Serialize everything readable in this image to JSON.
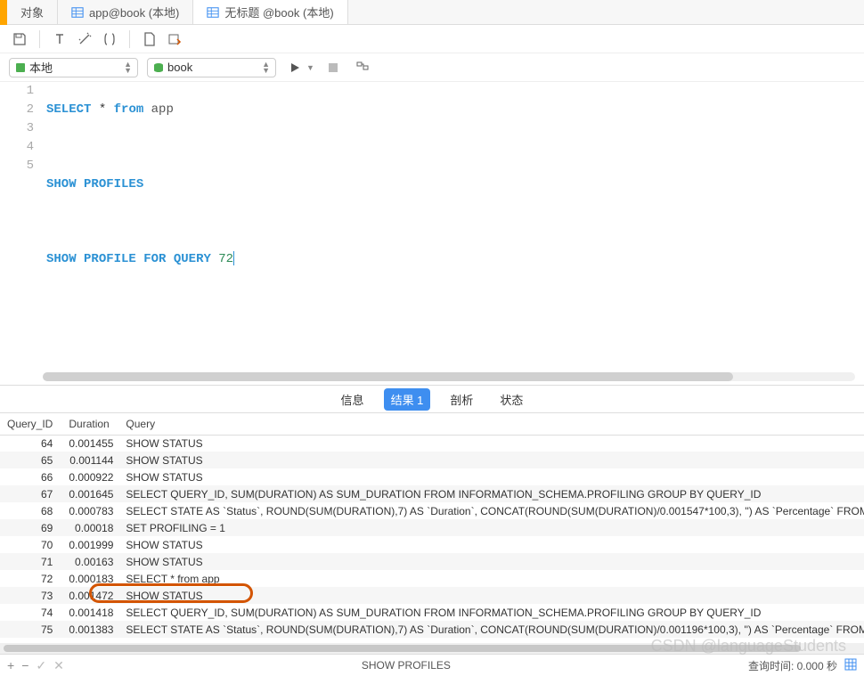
{
  "tabs": {
    "t0": {
      "label": "对象"
    },
    "t1": {
      "label": "app@book (本地)"
    },
    "t2": {
      "label": "无标题 @book (本地)"
    }
  },
  "dropdowns": {
    "connection": "本地",
    "database": "book"
  },
  "editor": {
    "line_numbers": [
      "1",
      "2",
      "3",
      "4",
      "5"
    ],
    "lines": {
      "l1": {
        "a": "SELECT",
        "b": "*",
        "c": "from",
        "d": "app"
      },
      "l3": {
        "a": "SHOW",
        "b": "PROFILES"
      },
      "l5": {
        "a": "SHOW",
        "b": "PROFILE",
        "c": "FOR",
        "d": "QUERY",
        "e": "72"
      }
    }
  },
  "result_tabs": {
    "info": "信息",
    "result1": "结果 1",
    "profile": "剖析",
    "status": "状态"
  },
  "table": {
    "headers": {
      "qid": "Query_ID",
      "dur": "Duration",
      "query": "Query"
    },
    "rows": [
      {
        "qid": "64",
        "dur": "0.001455",
        "query": "SHOW STATUS"
      },
      {
        "qid": "65",
        "dur": "0.001144",
        "query": "SHOW STATUS"
      },
      {
        "qid": "66",
        "dur": "0.000922",
        "query": "SHOW STATUS"
      },
      {
        "qid": "67",
        "dur": "0.001645",
        "query": "SELECT QUERY_ID, SUM(DURATION) AS SUM_DURATION FROM INFORMATION_SCHEMA.PROFILING GROUP BY QUERY_ID"
      },
      {
        "qid": "68",
        "dur": "0.000783",
        "query": "SELECT STATE AS `Status`, ROUND(SUM(DURATION),7) AS `Duration`, CONCAT(ROUND(SUM(DURATION)/0.001547*100,3), '') AS `Percentage` FROM"
      },
      {
        "qid": "69",
        "dur": "0.00018",
        "query": "SET PROFILING = 1"
      },
      {
        "qid": "70",
        "dur": "0.001999",
        "query": "SHOW STATUS"
      },
      {
        "qid": "71",
        "dur": "0.00163",
        "query": "SHOW STATUS"
      },
      {
        "qid": "72",
        "dur": "0.000183",
        "query": "SELECT * from app"
      },
      {
        "qid": "73",
        "dur": "0.001472",
        "query": "SHOW STATUS"
      },
      {
        "qid": "74",
        "dur": "0.001418",
        "query": "SELECT QUERY_ID, SUM(DURATION) AS SUM_DURATION FROM INFORMATION_SCHEMA.PROFILING GROUP BY QUERY_ID"
      },
      {
        "qid": "75",
        "dur": "0.001383",
        "query": "SELECT STATE AS `Status`, ROUND(SUM(DURATION),7) AS `Duration`, CONCAT(ROUND(SUM(DURATION)/0.001196*100,3), '') AS `Percentage` FROM"
      }
    ]
  },
  "statusbar": {
    "center": "SHOW PROFILES",
    "right": "查询时间: 0.000 秒"
  },
  "watermark": "CSDN @languageStudents"
}
